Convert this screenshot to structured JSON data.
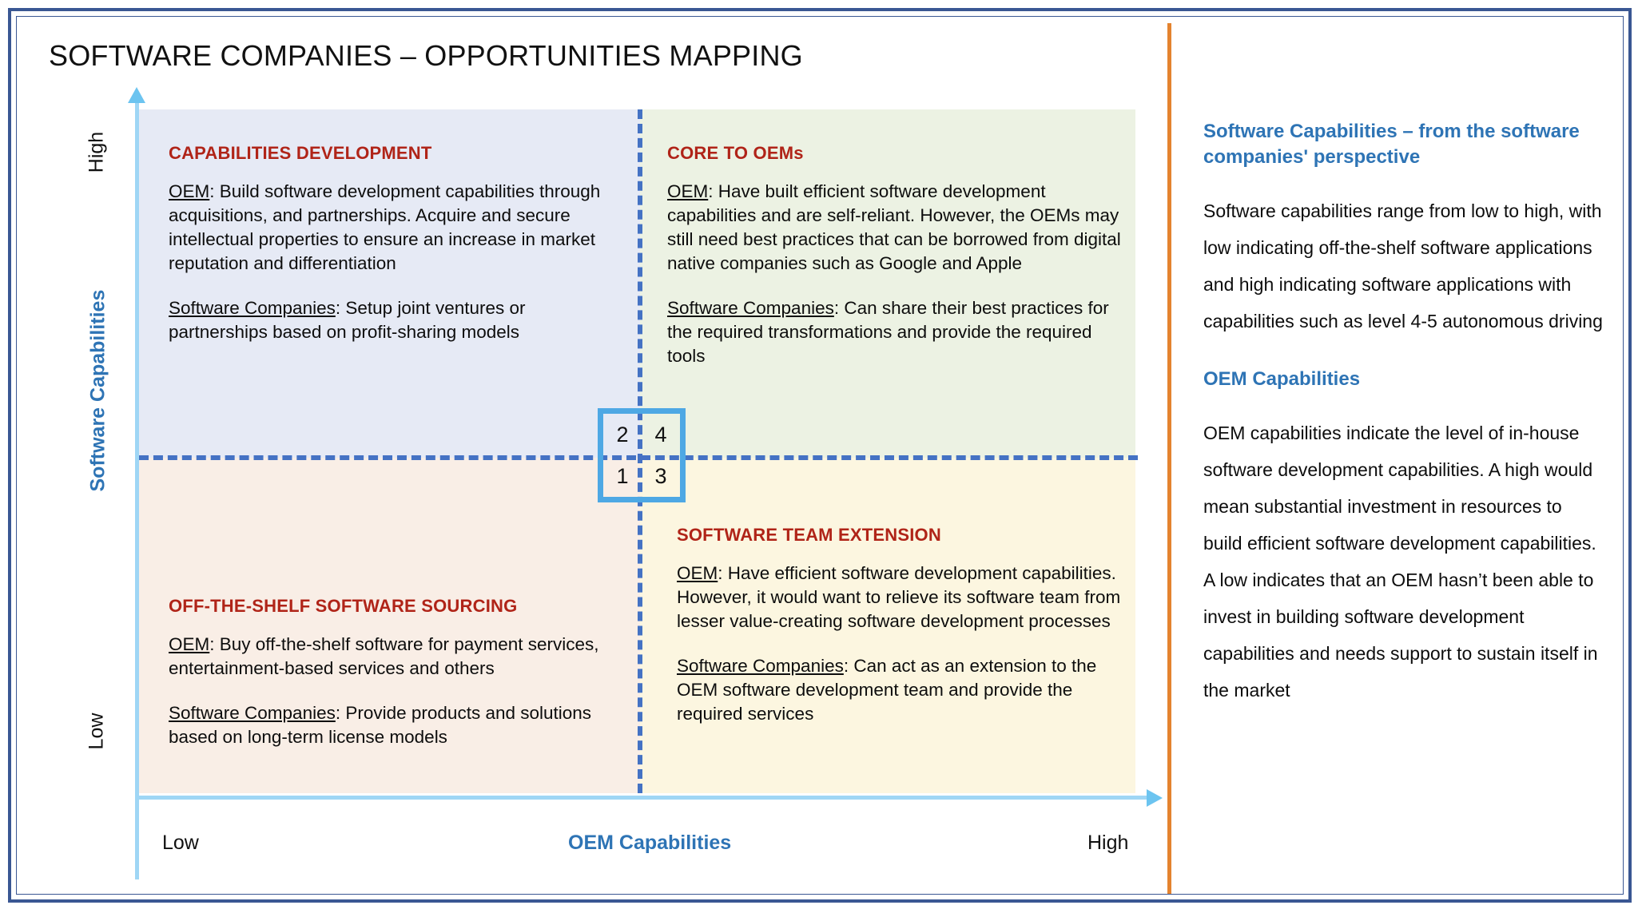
{
  "slide": {
    "title": "SOFTWARE COMPANIES – OPPORTUNITIES MAPPING",
    "border_color": "#3a5793",
    "divider_color": "#e4832f"
  },
  "axes": {
    "y_title": "Software Capabilities",
    "y_high": "High",
    "y_low": "Low",
    "x_title": "OEM Capabilities",
    "x_low": "Low",
    "x_high": "High",
    "axis_color": "#9fd6f5",
    "axis_title_color": "#2e74b5"
  },
  "quadrants": {
    "top_left": {
      "heading": "CAPABILITIES DEVELOPMENT",
      "bg": "#e6eaf5",
      "oem_lead": "OEM",
      "oem_text": ": Build software development capabilities through acquisitions, and partnerships. Acquire and secure intellectual properties to ensure an increase in market reputation and differentiation",
      "sw_lead": "Software Companies",
      "sw_text": ": Setup joint ventures or partnerships based on profit-sharing models"
    },
    "top_right": {
      "heading": "CORE TO OEMs",
      "bg": "#ecf2e3",
      "oem_lead": "OEM",
      "oem_text": ": Have built efficient software development capabilities and are self-reliant. However, the OEMs may still need best practices that can be borrowed from digital native companies such as Google and Apple",
      "sw_lead": "Software Companies",
      "sw_text": ": Can share their best practices for the required transformations and provide the required tools"
    },
    "bottom_left": {
      "heading": "OFF-THE-SHELF SOFTWARE SOURCING",
      "bg": "#f9eee6",
      "oem_lead": "OEM",
      "oem_text": ": Buy off-the-shelf software for payment services, entertainment-based services and others",
      "sw_lead": "Software Companies",
      "sw_text": ": Provide products and solutions based on long-term license models"
    },
    "bottom_right": {
      "heading": "SOFTWARE TEAM EXTENSION",
      "bg": "#fcf6e0",
      "oem_lead": "OEM",
      "oem_text": ": Have efficient software development capabilities. However, it would want to relieve its software team from lesser value-creating software development processes",
      "sw_lead": "Software Companies",
      "sw_text": ": Can act as an extension to the OEM software development team and provide the required services"
    }
  },
  "center_key": {
    "border_color": "#4ea8e4",
    "top_left_number": "2",
    "top_right_number": "4",
    "bottom_left_number": "1",
    "bottom_right_number": "3"
  },
  "sidebar": {
    "heading_1": "Software Capabilities – from the software companies' perspective",
    "para_1": "Software capabilities range from low to high, with low indicating off-the-shelf software applications and high indicating software applications with capabilities such as level 4-5 autonomous driving",
    "heading_2": "OEM Capabilities",
    "para_2": "OEM capabilities indicate the level of in-house software development capabilities. A high would mean substantial investment in resources to build efficient software development capabilities. A low indicates that an OEM hasn’t been able to invest in building software development capabilities and needs support to sustain itself in the market"
  }
}
